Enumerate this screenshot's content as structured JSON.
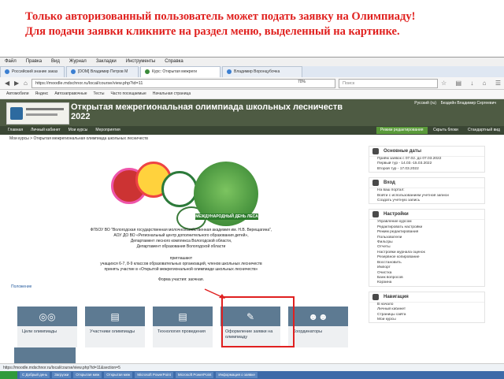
{
  "caption": {
    "line1": "Только авторизованный пользователь может подать заявку на Олимпиаду!",
    "line2": "Для подачи заявки кликните на раздел меню, выделенный на картинке."
  },
  "browser": {
    "menu": [
      "Файл",
      "Правка",
      "Вид",
      "Журнал",
      "Закладки",
      "Инструменты",
      "Справка"
    ],
    "tabs": [
      {
        "label": "Российский знание заказ"
      },
      {
        "label": "[DOM] Владимир Петров M"
      },
      {
        "label": "Курс: Открытая межреги",
        "active": true
      },
      {
        "label": "Владимир Воронцубочка"
      }
    ],
    "url": "https://moodle.mdschnor.ru/local/course/view.php?id=11",
    "zoom": "70%",
    "search_placeholder": "Поиск",
    "bookmarks": [
      "Автомобили",
      "Яндекс",
      "Автозаправочные",
      "Тесты",
      "Часто посещаемые",
      "Начальная страница"
    ]
  },
  "site": {
    "title_line1": "Открытая межрегиональная олимпиада школьных лесничеств",
    "title_line2": "2022",
    "lang": "Русский (ru)",
    "user": "Бездейн Владимир Сергеевич",
    "nav": [
      "Главная",
      "Личный кабинет",
      "Мои курсы",
      "Мероприятия"
    ],
    "edit_mode": "Режим редактирования",
    "nav_right": [
      "Скрыть блоки",
      "Стандартный вид"
    ],
    "breadcrumb": "Мои курсы  >  Открытая межрегиональная олимпиада школьных лесничеств",
    "globe_text": "МЕЖДУНАРОДНЫЙ ДЕНЬ ЛЕСА",
    "intro_lines": [
      "ФГБОУ ВО \"Вологодская государственная молочнохозяйственная академия им. Н.В. Верещагина\",",
      "АОУ ДО ВО «Региональный центр дополнительного образования детей»,",
      "Департамент лесного комплекса Вологодской области,",
      "Департамент образования Вологодской области"
    ],
    "invite_lines": [
      "приглашают",
      "учащихся 6-7, 8-9 классов образовательных организаций, членов школьных лесничеств",
      "принять участие в «Открытой межрегиональной олимпиаде школьных лесничеств»"
    ],
    "form_line": "Форма участия: заочная.",
    "section_heading": "Положение",
    "tiles": [
      {
        "label": "Цели олимпиады"
      },
      {
        "label": "Участники олимпиады"
      },
      {
        "label": "Технология проведения"
      },
      {
        "label": "Оформление заявки на олимпиаду"
      },
      {
        "label": "Координаторы"
      }
    ],
    "status_url": "https://moodle.mdschnor.ru/local/course/view.php?id=11&section=5",
    "taskbar": [
      "С Добрый день",
      "Загрузки",
      "Открытая меж",
      "Открытая меж",
      "Microsoft PowerPoint",
      "Microsoft PowerPoint",
      "Информация о заявке"
    ],
    "sidebar": [
      {
        "title": "Основные даты",
        "lines": [
          "Приём заявок с 07.02. до 07.03.2022",
          "Первый тур - 14.03.-15.03.2022",
          "Второй тур - 17.03.2022"
        ]
      },
      {
        "title": "Вход",
        "lines": [
          "На ваш портал:",
          "Войти с использованием учетной записи",
          "Создать учетную запись"
        ]
      },
      {
        "title": "Настройки",
        "lines": [
          "Управление курсом",
          "Редактировать настройки",
          "Режим редактирования",
          "Пользователи",
          "Фильтры",
          "Отчеты",
          "Настройки журнала оценок",
          "Резервное копирование",
          "Восстановить",
          "Импорт",
          "Очистка",
          "Банк вопросов",
          "Корзина"
        ]
      },
      {
        "title": "Навигация",
        "lines": [
          "В начало",
          "Личный кабинет",
          "Страницы сайта",
          "Мои курсы"
        ]
      }
    ]
  }
}
